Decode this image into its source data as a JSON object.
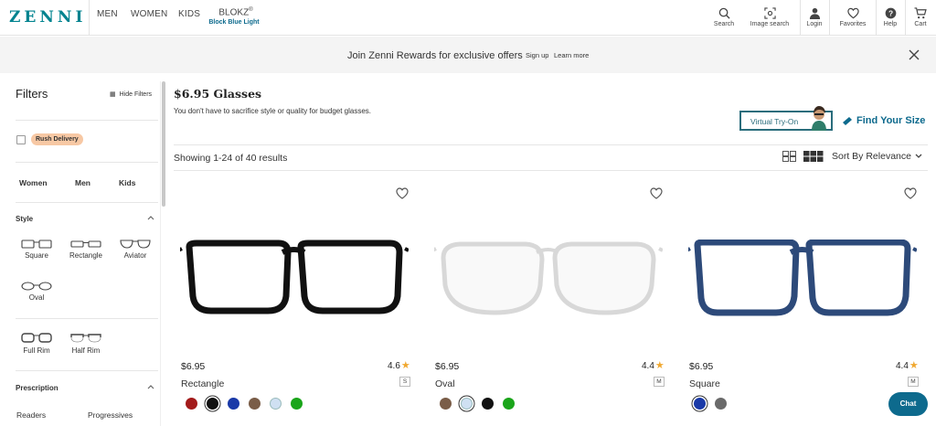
{
  "header": {
    "logo": "ZENNI",
    "nav": [
      "MEN",
      "WOMEN",
      "KIDS"
    ],
    "blokz": {
      "label": "BLOKZ",
      "mark": "®",
      "sub": "Block Blue Light"
    },
    "icons": [
      {
        "icon": "search-icon",
        "label": "Search"
      },
      {
        "icon": "camera-icon",
        "label": "Image search"
      },
      {
        "icon": "user-icon",
        "label": "Login"
      },
      {
        "icon": "heart-icon",
        "label": "Favorites"
      },
      {
        "icon": "help-icon",
        "label": "Help"
      },
      {
        "icon": "cart-icon",
        "label": "Cart"
      }
    ]
  },
  "promo": {
    "text": "Join Zenni Rewards for exclusive offers",
    "signup": "Sign up",
    "learn": "Learn more"
  },
  "sidebar": {
    "title": "Filters",
    "hide": "Hide Filters",
    "rush": "Rush Delivery",
    "genders": [
      "Women",
      "Men",
      "Kids"
    ],
    "style_title": "Style",
    "styles": [
      "Square",
      "Rectangle",
      "Aviator",
      "Oval"
    ],
    "rims": [
      "Full Rim",
      "Half Rim"
    ],
    "rx_title": "Prescription",
    "rx": [
      "Readers",
      "Progressives"
    ]
  },
  "main": {
    "title": "$6.95 Glasses",
    "subtitle": "You don't have to sacrifice style or quality for budget glasses.",
    "vto": "Virtual Try-On",
    "fys": "Find Your Size",
    "results": "Showing 1-24 of 40 results",
    "sort": "Sort By Relevance"
  },
  "products": [
    {
      "price": "$6.95",
      "rating": "4.6",
      "size": "S",
      "shape": "Rectangle",
      "frame_color": "#111111",
      "colors": [
        "#a31b1b",
        "#111111",
        "#1a3aa8",
        "#7a5d48",
        "#cfe0f2",
        "#1aa51a"
      ],
      "selected": 1
    },
    {
      "price": "$6.95",
      "rating": "4.4",
      "size": "M",
      "shape": "Oval",
      "frame_color": "#d8d8d8",
      "colors": [
        "#7a5d48",
        "#cfe0f2",
        "#111111",
        "#1aa51a"
      ],
      "selected": 1
    },
    {
      "price": "$6.95",
      "rating": "4.4",
      "size": "M",
      "shape": "Square",
      "frame_color": "#2d4a7a",
      "colors": [
        "#1a3aa8",
        "#6a6a6a"
      ],
      "selected": 0
    }
  ],
  "chat": "Chat"
}
